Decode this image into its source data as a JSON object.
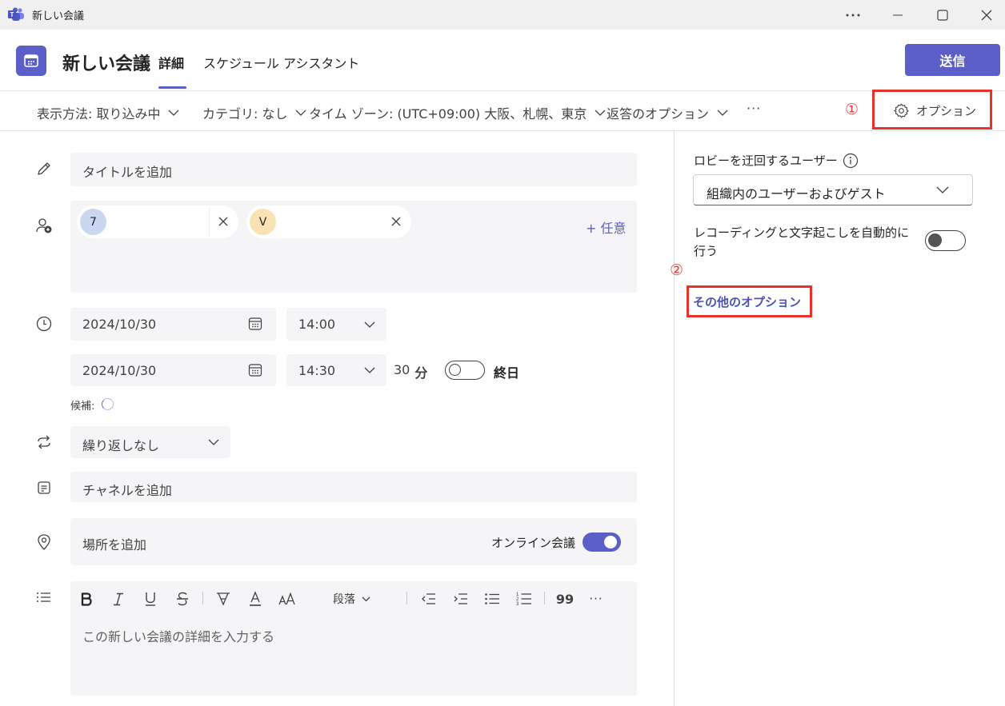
{
  "window": {
    "title": "新しい会議"
  },
  "header": {
    "meeting_title": "新しい会議",
    "tabs": [
      {
        "label": "詳細",
        "active": true
      },
      {
        "label": "スケジュール アシスタント",
        "active": false
      }
    ],
    "send_label": "送信"
  },
  "toolbar": {
    "show_as": "表示方法: 取り込み中",
    "category": "カテゴリ: なし",
    "timezone": "タイム ゾーン: (UTC+09:00) 大阪、札幌、東京",
    "response": "返答のオプション",
    "more": "···",
    "options_label": "オプション"
  },
  "annotations": {
    "one": "①",
    "two": "②"
  },
  "form": {
    "title_placeholder": "タイトルを追加",
    "attendees": [
      {
        "initial": "7",
        "color": "#c9d7f0"
      },
      {
        "initial": "V",
        "color": "#fbe2b5"
      }
    ],
    "optional_label": "+ 任意",
    "start_date": "2024/10/30",
    "start_time": "14:00",
    "end_date": "2024/10/30",
    "end_time": "14:30",
    "duration_value": "30",
    "duration_unit": "分",
    "all_day_label": "終日",
    "all_day": false,
    "suggestions_label": "候補:",
    "repeat": "繰り返しなし",
    "channel_placeholder": "チャネルを追加",
    "location_placeholder": "場所を追加",
    "online_label": "オンライン会議",
    "online": true,
    "details_placeholder": "この新しい会議の詳細を入力する",
    "rte": {
      "paragraph": "段落",
      "quote": "99",
      "more": "···"
    }
  },
  "options_panel": {
    "lobby_label": "ロビーを迂回するユーザー",
    "lobby_value": "組織内のユーザーおよびゲスト",
    "recording_label": "レコーディングと文字起こしを自動的に行う",
    "recording_on": false,
    "more_options_link": "その他のオプション"
  },
  "colors": {
    "accent": "#5b5fc7",
    "annotation_red": "#e8312a"
  }
}
